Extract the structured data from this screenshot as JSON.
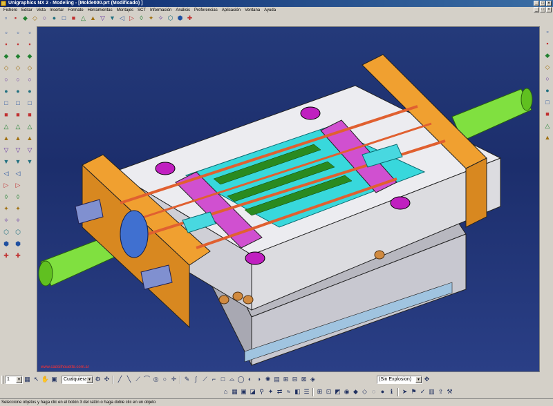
{
  "window": {
    "title": "Unigraphics NX 2 - Modeling - [Molde000.prt (Modificado) ]"
  },
  "menu": [
    "Fichero",
    "Editar",
    "Vista",
    "Insertar",
    "Formato",
    "Herramientas",
    "Montajes",
    "SCT",
    "Información",
    "Análisis",
    "Preferencias",
    "Aplicación",
    "Ventana",
    "Ayuda"
  ],
  "bottom_toolbar": {
    "layer_value": "1",
    "filter_value": "Cualquiera",
    "explosion_value": "(Sin Explosion)"
  },
  "viewport": {
    "watermark": "www.cadsilhouette.com.ar"
  },
  "status": {
    "message": "Seleccione objetos y haga clic en el botón 3 del ratón o haga doble clic en un objeto"
  },
  "icons": {
    "top": [
      "new-icon",
      "open-icon",
      "save-icon",
      "print-icon",
      "cut-icon",
      "copy-icon",
      "paste-icon",
      "delete-icon",
      "undo-icon",
      "redo-icon",
      "fit-icon",
      "zoom-icon",
      "pan-icon",
      "rotate-icon",
      "refresh-icon",
      "view-icon",
      "shading-icon",
      "wireframe-icon",
      "layer-icon",
      "model-icon"
    ],
    "left_col1": [
      "sketch-icon",
      "extrude-icon",
      "revolve-icon",
      "hole-icon",
      "boss-icon",
      "pocket-icon",
      "pad-icon",
      "slot-icon",
      "groove-icon",
      "block-icon",
      "cylinder-icon",
      "cone-icon",
      "sphere-icon",
      "tube-icon",
      "unite-icon",
      "subtract-icon",
      "intersect-icon",
      "blend-icon",
      "chamfer-icon",
      "shell-icon"
    ],
    "left_col2": [
      "sweep-icon",
      "thread-icon",
      "instance-icon",
      "mirror-icon",
      "pattern-icon",
      "trim-icon",
      "split-icon",
      "offset-icon",
      "scale-icon",
      "draft-icon",
      "edit-icon",
      "feature-icon",
      "surface-icon",
      "curve-icon",
      "point-icon",
      "line-icon",
      "arc-icon",
      "spline-icon",
      "plane-icon",
      "axis-icon"
    ],
    "right": [
      "assembly-icon",
      "component-icon",
      "constraint-icon",
      "explode-icon",
      "tool-icon",
      "hat-icon",
      "palette-icon",
      "resource-icon",
      "history-icon",
      "web-icon"
    ]
  }
}
